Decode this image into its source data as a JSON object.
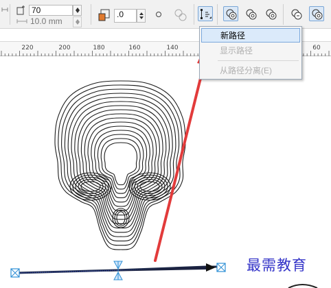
{
  "toolbar": {
    "count_value": "70",
    "spacing_value": "10.0 mm",
    "rotation_value": ".0",
    "icons": [
      "blend-steps-icon",
      "spacing-icon",
      "rotation-icon",
      "loop-icon",
      "blend-fill-icon",
      "path-properties-icon",
      "blend-direct-icon",
      "blend-clockwise-icon",
      "blend-counterclockwise-icon",
      "object-color-acceleration-icon",
      "resize-acceleration-icon"
    ]
  },
  "menu": {
    "items": [
      {
        "label": "新路径",
        "enabled": true,
        "highlighted": true
      },
      {
        "label": "显示路径",
        "enabled": false
      },
      {
        "label": "从路径分离(E)",
        "enabled": false
      }
    ]
  },
  "ruler": {
    "ticks": [
      "220",
      "200",
      "180",
      "160",
      "140",
      "60"
    ]
  },
  "watermark": "最需教育",
  "colors": {
    "arrow": "#e23b3b",
    "highlight": "#dbeafa",
    "handle": "#2d8fd6",
    "watermark": "#3434c8"
  }
}
